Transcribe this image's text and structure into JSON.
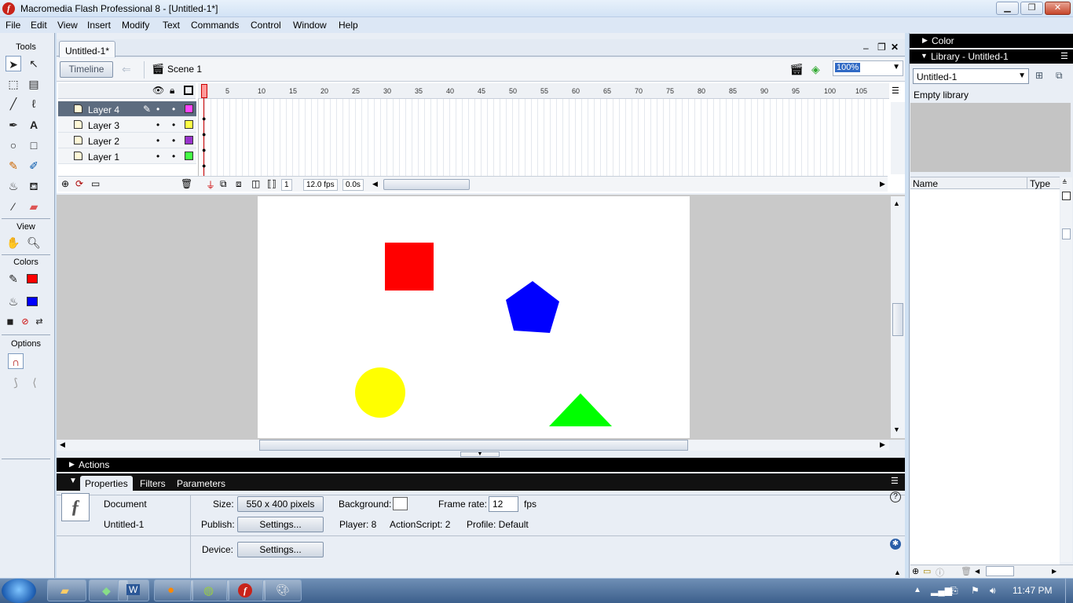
{
  "window": {
    "title": "Macromedia Flash Professional 8 - [Untitled-1*]"
  },
  "menu": [
    "File",
    "Edit",
    "View",
    "Insert",
    "Modify",
    "Text",
    "Commands",
    "Control",
    "Window",
    "Help"
  ],
  "tools": {
    "header": "Tools",
    "view": "View",
    "colors": "Colors",
    "options": "Options",
    "stroke_color": "#ff0000",
    "fill_color": "#0000ff"
  },
  "document": {
    "tab": "Untitled-1*",
    "timeline_button": "Timeline",
    "scene": "Scene 1",
    "zoom": "100%"
  },
  "timeline": {
    "layers": [
      {
        "name": "Layer 4",
        "color": "#ff44ff",
        "active": true
      },
      {
        "name": "Layer 3",
        "color": "#ffff44"
      },
      {
        "name": "Layer 2",
        "color": "#9933cc"
      },
      {
        "name": "Layer 1",
        "color": "#44ff44"
      }
    ],
    "ruler": [
      "1",
      "5",
      "10",
      "15",
      "20",
      "25",
      "30",
      "35",
      "40",
      "45",
      "50",
      "55",
      "60",
      "65",
      "70",
      "75",
      "80",
      "85",
      "90",
      "95",
      "100",
      "105"
    ],
    "current_frame": "1",
    "fps": "12.0 fps",
    "time": "0.0s"
  },
  "stage": {
    "shapes": [
      {
        "name": "red-square",
        "color": "#ff0000"
      },
      {
        "name": "blue-pentagon",
        "color": "#0000ff"
      },
      {
        "name": "yellow-circle",
        "color": "#ffff00"
      },
      {
        "name": "green-triangle",
        "color": "#00ff00"
      }
    ]
  },
  "actions": {
    "label": "Actions"
  },
  "properties": {
    "tabs": [
      "Properties",
      "Filters",
      "Parameters"
    ],
    "doc_label": "Document",
    "doc_name": "Untitled-1",
    "size_label": "Size:",
    "size_value": "550 x 400 pixels",
    "background_label": "Background:",
    "framerate_label": "Frame rate:",
    "framerate_value": "12",
    "fps_label": "fps",
    "publish_label": "Publish:",
    "settings_label": "Settings...",
    "player": "Player: 8",
    "actionscript": "ActionScript: 2",
    "profile": "Profile: Default",
    "device_label": "Device:"
  },
  "right": {
    "color_panel": "Color",
    "library_panel": "Library - Untitled-1",
    "library_select": "Untitled-1",
    "empty": "Empty library",
    "col_name": "Name",
    "col_type": "Type"
  },
  "taskbar": {
    "clock": "11:47 PM"
  }
}
